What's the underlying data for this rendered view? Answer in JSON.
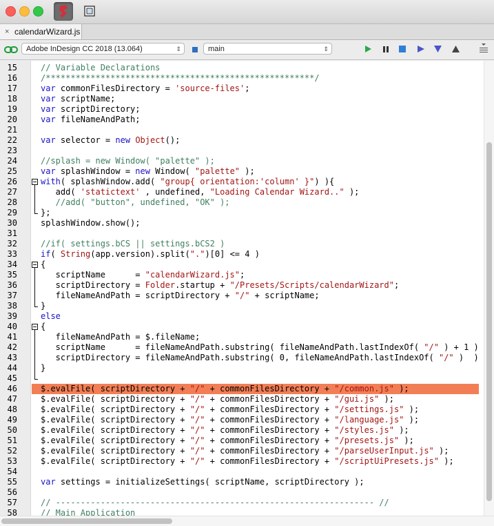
{
  "window": {
    "tab_close": "×",
    "tab_title": "calendarWizard.js"
  },
  "toolbar": {
    "target_app": "Adobe InDesign CC 2018 (13.064)",
    "engine": "main",
    "colors": {
      "run": "#2aa84a",
      "debug": "#4a55c9",
      "stop": "#2f7fd7"
    }
  },
  "editor": {
    "highlight_color": "#f27e55",
    "lines": [
      {
        "n": "15",
        "segs": [
          {
            "t": "// Variable Declarations",
            "c": "com"
          }
        ]
      },
      {
        "n": "16",
        "segs": [
          {
            "t": "/******************************************************/",
            "c": "com"
          }
        ]
      },
      {
        "n": "17",
        "segs": [
          {
            "t": "var",
            "c": "kw"
          },
          {
            "t": " commonFilesDirectory = ",
            "c": ""
          },
          {
            "t": "'source-files'",
            "c": "str"
          },
          {
            "t": ";",
            "c": ""
          }
        ]
      },
      {
        "n": "18",
        "segs": [
          {
            "t": "var",
            "c": "kw"
          },
          {
            "t": " scriptName;",
            "c": ""
          }
        ]
      },
      {
        "n": "19",
        "segs": [
          {
            "t": "var",
            "c": "kw"
          },
          {
            "t": " scriptDirectory;",
            "c": ""
          }
        ]
      },
      {
        "n": "20",
        "segs": [
          {
            "t": "var",
            "c": "kw"
          },
          {
            "t": " fileNameAndPath;",
            "c": ""
          }
        ]
      },
      {
        "n": "21",
        "segs": []
      },
      {
        "n": "22",
        "segs": [
          {
            "t": "var",
            "c": "kw"
          },
          {
            "t": " selector = ",
            "c": ""
          },
          {
            "t": "new",
            "c": "kw"
          },
          {
            "t": " ",
            "c": ""
          },
          {
            "t": "Object",
            "c": "str"
          },
          {
            "t": "();",
            "c": ""
          }
        ]
      },
      {
        "n": "23",
        "segs": []
      },
      {
        "n": "24",
        "segs": [
          {
            "t": "//splash = new Window( \"palette\" );",
            "c": "com"
          }
        ]
      },
      {
        "n": "25",
        "segs": [
          {
            "t": "var",
            "c": "kw"
          },
          {
            "t": " splashWindow = ",
            "c": ""
          },
          {
            "t": "new",
            "c": "kw"
          },
          {
            "t": " Window( ",
            "c": ""
          },
          {
            "t": "\"palette\"",
            "c": "str"
          },
          {
            "t": " );",
            "c": ""
          }
        ]
      },
      {
        "n": "26",
        "fold": "open",
        "segs": [
          {
            "t": "with",
            "c": "kw"
          },
          {
            "t": "( splashWindow.add( ",
            "c": ""
          },
          {
            "t": "\"group{ orientation:'column' }\"",
            "c": "str"
          },
          {
            "t": ") ){",
            "c": ""
          }
        ]
      },
      {
        "n": "27",
        "fold": "mid",
        "segs": [
          {
            "t": "   add( ",
            "c": ""
          },
          {
            "t": "'statictext'",
            "c": "str"
          },
          {
            "t": " , undefined, ",
            "c": ""
          },
          {
            "t": "\"Loading Calendar Wizard..\"",
            "c": "str"
          },
          {
            "t": " );",
            "c": ""
          }
        ]
      },
      {
        "n": "28",
        "fold": "mid",
        "segs": [
          {
            "t": "   //add( \"button\", undefined, \"OK\" );",
            "c": "com"
          }
        ]
      },
      {
        "n": "29",
        "fold": "end",
        "segs": [
          {
            "t": "};",
            "c": ""
          }
        ]
      },
      {
        "n": "30",
        "segs": [
          {
            "t": "splashWindow.show();",
            "c": ""
          }
        ]
      },
      {
        "n": "31",
        "segs": []
      },
      {
        "n": "32",
        "segs": [
          {
            "t": "//if( settings.bCS || settings.bCS2 )",
            "c": "com"
          }
        ]
      },
      {
        "n": "33",
        "segs": [
          {
            "t": "if",
            "c": "kw"
          },
          {
            "t": "( ",
            "c": ""
          },
          {
            "t": "String",
            "c": "str"
          },
          {
            "t": "(app.version).split(",
            "c": ""
          },
          {
            "t": "\".\"",
            "c": "str"
          },
          {
            "t": ")[0] <= 4 )",
            "c": ""
          }
        ]
      },
      {
        "n": "34",
        "fold": "open",
        "segs": [
          {
            "t": "{",
            "c": ""
          }
        ]
      },
      {
        "n": "35",
        "fold": "mid",
        "segs": [
          {
            "t": "   scriptName      = ",
            "c": ""
          },
          {
            "t": "\"calendarWizard.js\"",
            "c": "str"
          },
          {
            "t": ";",
            "c": ""
          }
        ]
      },
      {
        "n": "36",
        "fold": "mid",
        "segs": [
          {
            "t": "   scriptDirectory = ",
            "c": ""
          },
          {
            "t": "Folder",
            "c": "str"
          },
          {
            "t": ".startup + ",
            "c": ""
          },
          {
            "t": "\"/Presets/Scripts/calendarWizard\"",
            "c": "str"
          },
          {
            "t": ";",
            "c": ""
          }
        ]
      },
      {
        "n": "37",
        "fold": "mid",
        "segs": [
          {
            "t": "   fileNameAndPath = scriptDirectory + ",
            "c": ""
          },
          {
            "t": "\"/\"",
            "c": "str"
          },
          {
            "t": " + scriptName;",
            "c": ""
          }
        ]
      },
      {
        "n": "38",
        "fold": "end",
        "segs": [
          {
            "t": "}",
            "c": ""
          }
        ]
      },
      {
        "n": "39",
        "segs": [
          {
            "t": "else",
            "c": "kw"
          }
        ]
      },
      {
        "n": "40",
        "fold": "open",
        "segs": [
          {
            "t": "{",
            "c": ""
          }
        ]
      },
      {
        "n": "41",
        "fold": "mid",
        "segs": [
          {
            "t": "   fileNameAndPath = $.fileName;",
            "c": ""
          }
        ]
      },
      {
        "n": "42",
        "fold": "mid",
        "segs": [
          {
            "t": "   scriptName      = fileNameAndPath.substring( fileNameAndPath.lastIndexOf( ",
            "c": ""
          },
          {
            "t": "\"/\"",
            "c": "str"
          },
          {
            "t": " ) + 1 )",
            "c": ""
          }
        ]
      },
      {
        "n": "43",
        "fold": "mid",
        "segs": [
          {
            "t": "   scriptDirectory = fileNameAndPath.substring( 0, fileNameAndPath.lastIndexOf( ",
            "c": ""
          },
          {
            "t": "\"/\"",
            "c": "str"
          },
          {
            "t": " )  )",
            "c": ""
          }
        ]
      },
      {
        "n": "44",
        "fold": "mid",
        "segs": [
          {
            "t": "}",
            "c": ""
          }
        ]
      },
      {
        "n": "45",
        "fold": "end",
        "segs": []
      },
      {
        "n": "46",
        "highlight": true,
        "segs": [
          {
            "t": "$.evalFile( scriptDirectory + ",
            "c": ""
          },
          {
            "t": "\"/\"",
            "c": "str"
          },
          {
            "t": " + commonFilesDirectory + ",
            "c": ""
          },
          {
            "t": "\"/common.js\"",
            "c": "str"
          },
          {
            "t": " );",
            "c": ""
          }
        ]
      },
      {
        "n": "47",
        "segs": [
          {
            "t": "$.evalFile( scriptDirectory + ",
            "c": ""
          },
          {
            "t": "\"/\"",
            "c": "str"
          },
          {
            "t": " + commonFilesDirectory + ",
            "c": ""
          },
          {
            "t": "\"/gui.js\"",
            "c": "str"
          },
          {
            "t": " );",
            "c": ""
          }
        ]
      },
      {
        "n": "48",
        "segs": [
          {
            "t": "$.evalFile( scriptDirectory + ",
            "c": ""
          },
          {
            "t": "\"/\"",
            "c": "str"
          },
          {
            "t": " + commonFilesDirectory + ",
            "c": ""
          },
          {
            "t": "\"/settings.js\"",
            "c": "str"
          },
          {
            "t": " );",
            "c": ""
          }
        ]
      },
      {
        "n": "49",
        "segs": [
          {
            "t": "$.evalFile( scriptDirectory + ",
            "c": ""
          },
          {
            "t": "\"/\"",
            "c": "str"
          },
          {
            "t": " + commonFilesDirectory + ",
            "c": ""
          },
          {
            "t": "\"/language.js\"",
            "c": "str"
          },
          {
            "t": " );",
            "c": ""
          }
        ]
      },
      {
        "n": "50",
        "segs": [
          {
            "t": "$.evalFile( scriptDirectory + ",
            "c": ""
          },
          {
            "t": "\"/\"",
            "c": "str"
          },
          {
            "t": " + commonFilesDirectory + ",
            "c": ""
          },
          {
            "t": "\"/styles.js\"",
            "c": "str"
          },
          {
            "t": " );",
            "c": ""
          }
        ]
      },
      {
        "n": "51",
        "segs": [
          {
            "t": "$.evalFile( scriptDirectory + ",
            "c": ""
          },
          {
            "t": "\"/\"",
            "c": "str"
          },
          {
            "t": " + commonFilesDirectory + ",
            "c": ""
          },
          {
            "t": "\"/presets.js\"",
            "c": "str"
          },
          {
            "t": " );",
            "c": ""
          }
        ]
      },
      {
        "n": "52",
        "segs": [
          {
            "t": "$.evalFile( scriptDirectory + ",
            "c": ""
          },
          {
            "t": "\"/\"",
            "c": "str"
          },
          {
            "t": " + commonFilesDirectory + ",
            "c": ""
          },
          {
            "t": "\"/parseUserInput.js\"",
            "c": "str"
          },
          {
            "t": " );",
            "c": ""
          }
        ]
      },
      {
        "n": "53",
        "segs": [
          {
            "t": "$.evalFile( scriptDirectory + ",
            "c": ""
          },
          {
            "t": "\"/\"",
            "c": "str"
          },
          {
            "t": " + commonFilesDirectory + ",
            "c": ""
          },
          {
            "t": "\"/scriptUiPresets.js\"",
            "c": "str"
          },
          {
            "t": " );",
            "c": ""
          }
        ]
      },
      {
        "n": "54",
        "segs": []
      },
      {
        "n": "55",
        "segs": [
          {
            "t": "var",
            "c": "kw"
          },
          {
            "t": " settings = initializeSettings( scriptName, scriptDirectory );",
            "c": ""
          }
        ]
      },
      {
        "n": "56",
        "segs": []
      },
      {
        "n": "57",
        "segs": [
          {
            "t": "// ---------------------------------------------------------------- //",
            "c": "com"
          }
        ]
      },
      {
        "n": "58",
        "segs": [
          {
            "t": "// Main Application",
            "c": "com"
          }
        ]
      }
    ]
  }
}
